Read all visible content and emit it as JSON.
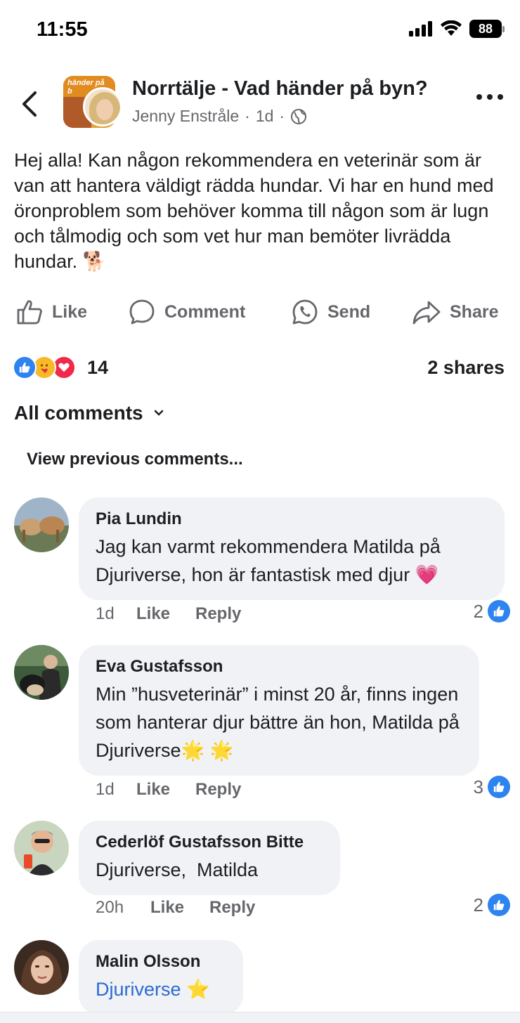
{
  "status_bar": {
    "time": "11:55",
    "battery": "88"
  },
  "header": {
    "group_name": "Norrtälje - Vad händer på byn?",
    "group_avatar_text": "händer på b",
    "author": "Jenny Enstråle",
    "separator": "·",
    "age": "1d",
    "icons": {
      "back": "chevron-left-icon",
      "more": "more-dots-icon",
      "audience": "globe-icon"
    }
  },
  "post": {
    "text": "Hej alla! Kan någon rekommendera en veterinär som är van att hantera väldigt rädda hundar. Vi har en hund med öronproblem som behöver komma till någon som är lugn och tålmodig och som vet hur man bemöter livrädda hundar. 🐕"
  },
  "actions": {
    "like": "Like",
    "comment": "Comment",
    "send": "Send",
    "share": "Share"
  },
  "reactions": {
    "types": [
      "like",
      "care",
      "love"
    ],
    "count": "14",
    "shares": "2 shares",
    "colors": {
      "like": "#2d83f0",
      "care": "#f7b928",
      "love": "#f0284a"
    }
  },
  "comments_section": {
    "filter_label": "All comments",
    "view_previous": "View previous comments..."
  },
  "comments": [
    {
      "name": "Pia Lundin",
      "text": "Jag kan varmt rekommendera Matilda på Djuriverse, hon är fantastisk med djur 💗",
      "time": "1d",
      "like": "Like",
      "reply": "Reply",
      "likes": "2"
    },
    {
      "name": "Eva Gustafsson",
      "text": "Min ”husveterinär” i minst 20 år, finns ingen som hanterar djur bättre än hon, Matilda på Djuriverse🌟 🌟",
      "time": "1d",
      "like": "Like",
      "reply": "Reply",
      "likes": "3"
    },
    {
      "name": "Cederlöf Gustafsson Bitte",
      "text": "Djuriverse,  Matilda",
      "time": "20h",
      "like": "Like",
      "reply": "Reply",
      "likes": "2"
    },
    {
      "name": "Malin Olsson",
      "link_text": "Djuriverse",
      "emoji": "⭐"
    }
  ],
  "colors": {
    "primary_text": "#1c1e21",
    "secondary_text": "#65676b",
    "bubble": "#f0f2f5",
    "link": "#2d6ad1",
    "like_blue": "#2d83f0"
  }
}
